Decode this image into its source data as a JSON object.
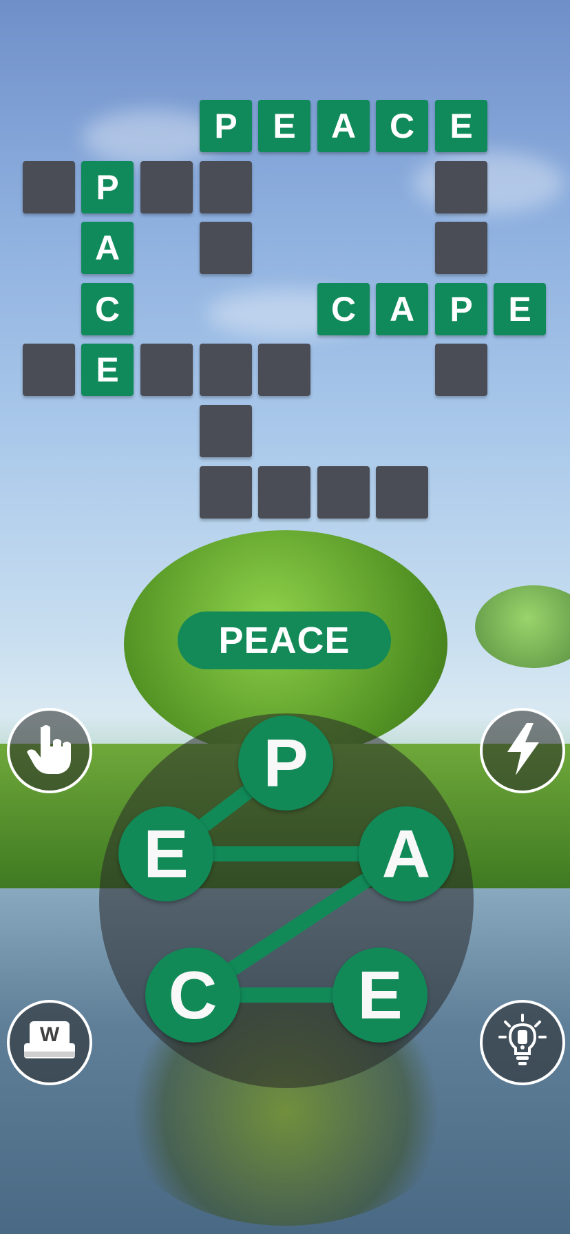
{
  "board": {
    "words": [
      {
        "word": "PEACE",
        "letters": [
          "P",
          "E",
          "A",
          "C",
          "E"
        ]
      },
      {
        "word": "PACE",
        "letters": [
          "P",
          "A",
          "C",
          "E"
        ]
      },
      {
        "word": "CAPE",
        "letters": [
          "C",
          "A",
          "P",
          "E"
        ]
      }
    ],
    "empty_cells": 17
  },
  "current_word": "PEACE",
  "wheel": {
    "letters": [
      "P",
      "E",
      "A",
      "C",
      "E"
    ],
    "selected_path": [
      "P",
      "E",
      "A",
      "C",
      "E"
    ]
  },
  "buttons": {
    "hand": "hand-pointer-icon",
    "lightning": "lightning-icon",
    "dictionary": "dictionary-w-icon",
    "hint": "lightbulb-icon"
  },
  "colors": {
    "tile_green": "#108a5a",
    "empty_tile": "#4a4d55",
    "letter_text": "#ffffff",
    "wheel_overlay": "rgba(40,40,40,0.55)"
  }
}
